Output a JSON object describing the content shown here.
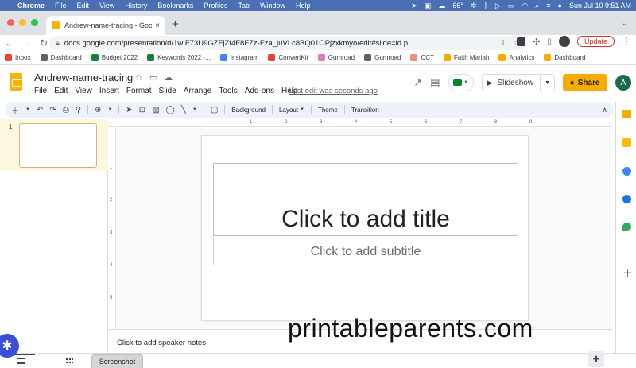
{
  "macbar": {
    "app": "Chrome",
    "menus": [
      "File",
      "Edit",
      "View",
      "History",
      "Bookmarks",
      "Profiles",
      "Tab",
      "Window",
      "Help"
    ],
    "weather": "66°",
    "datetime": "Sun Jul 10  9:51 AM"
  },
  "tab": {
    "title": "Andrew-name-tracing - Google Slides",
    "close": "×",
    "new_tab": "+"
  },
  "address": {
    "url": "docs.google.com/presentation/d/1wIF73U9GZFjZf4F8FZz-Fza_juVLc8BQ01OPjzxkmyo/edit#slide=id.p",
    "update_label": "Update"
  },
  "bookmarks": [
    {
      "label": "Inbox",
      "color": "#ea4335"
    },
    {
      "label": "Dashboard",
      "color": "#5f6368"
    },
    {
      "label": "Budget 2022",
      "color": "#188038"
    },
    {
      "label": "Keywords 2022 -...",
      "color": "#188038"
    },
    {
      "label": "Instagram",
      "color": "#4285f4"
    },
    {
      "label": "ConvertKit",
      "color": "#ea4335"
    },
    {
      "label": "Gumroad",
      "color": "#e377c2"
    },
    {
      "label": "Gumroad",
      "color": "#5f6368"
    },
    {
      "label": "CCT",
      "color": "#f28b82"
    },
    {
      "label": "Faith Mariah",
      "color": "#f9ab00"
    },
    {
      "label": "Analytics",
      "color": "#f9ab00"
    },
    {
      "label": "Dashboard",
      "color": "#f9ab00"
    }
  ],
  "doc": {
    "title": "Andrew-name-tracing",
    "menus": [
      "File",
      "Edit",
      "View",
      "Insert",
      "Format",
      "Slide",
      "Arrange",
      "Tools",
      "Add-ons",
      "Help"
    ],
    "last_edit": "Last edit was seconds ago",
    "slideshow_label": "Slideshow",
    "share_label": "Share",
    "avatar_letter": "A"
  },
  "toolbar": {
    "background": "Background",
    "layout": "Layout",
    "theme": "Theme",
    "transition": "Transition"
  },
  "filmstrip": {
    "slide_number": "1"
  },
  "ruler": {
    "top_ticks": [
      "1",
      "2",
      "3",
      "4",
      "5",
      "6",
      "7",
      "8",
      "9"
    ],
    "left_ticks": [
      "1",
      "2",
      "3",
      "4",
      "5"
    ]
  },
  "slide": {
    "title_placeholder": "Click to add title",
    "subtitle_placeholder": "Click to add subtitle"
  },
  "notes": {
    "placeholder": "Click to add speaker notes"
  },
  "watermark": "printableparents.com",
  "bottom": {
    "screenshot_tab": "Screenshot"
  },
  "colors": {
    "accent_yellow": "#f9ab00",
    "macbar_blue": "#4a6fb4",
    "toolbar_bg": "#edf2fa"
  }
}
